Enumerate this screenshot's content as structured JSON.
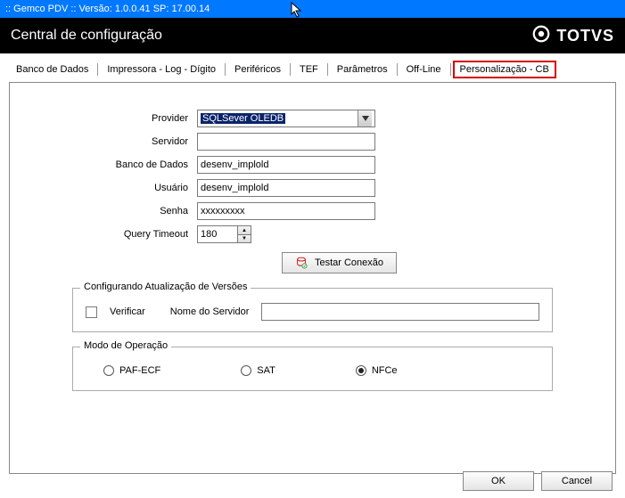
{
  "window": {
    "title": ":: Gemco PDV :: Versão: 1.0.0.41 SP: 17.00.14"
  },
  "header": {
    "title": "Central de configuração",
    "brand": "TOTVS"
  },
  "tabs": {
    "items": [
      "Banco de Dados",
      "Impressora - Log - Dígito",
      "Periféricos",
      "TEF",
      "Parâmetros",
      "Off-Line",
      "Personalização - CB"
    ],
    "activeIndex": 0,
    "highlightedIndex": 6
  },
  "form": {
    "provider": {
      "label": "Provider",
      "value": "SQLSever OLEDB"
    },
    "servidor": {
      "label": "Servidor",
      "value": ""
    },
    "banco": {
      "label": "Banco de Dados",
      "value": "desenv_implold"
    },
    "usuario": {
      "label": "Usuário",
      "value": "desenv_implold"
    },
    "senha": {
      "label": "Senha",
      "value": "xxxxxxxxx"
    },
    "timeout": {
      "label": "Query Timeout",
      "value": "180"
    },
    "test_btn": "Testar Conexão"
  },
  "version_group": {
    "title": "Configurando Atualização de Versões",
    "verificar_label": "Verificar",
    "verificar_checked": false,
    "nome_servidor_label": "Nome do Servidor",
    "nome_servidor_value": ""
  },
  "mode_group": {
    "title": "Modo de Operação",
    "options": [
      {
        "label": "PAF-ECF",
        "checked": false
      },
      {
        "label": "SAT",
        "checked": false
      },
      {
        "label": "NFCe",
        "checked": true
      }
    ]
  },
  "footer": {
    "ok": "OK",
    "cancel": "Cancel"
  }
}
